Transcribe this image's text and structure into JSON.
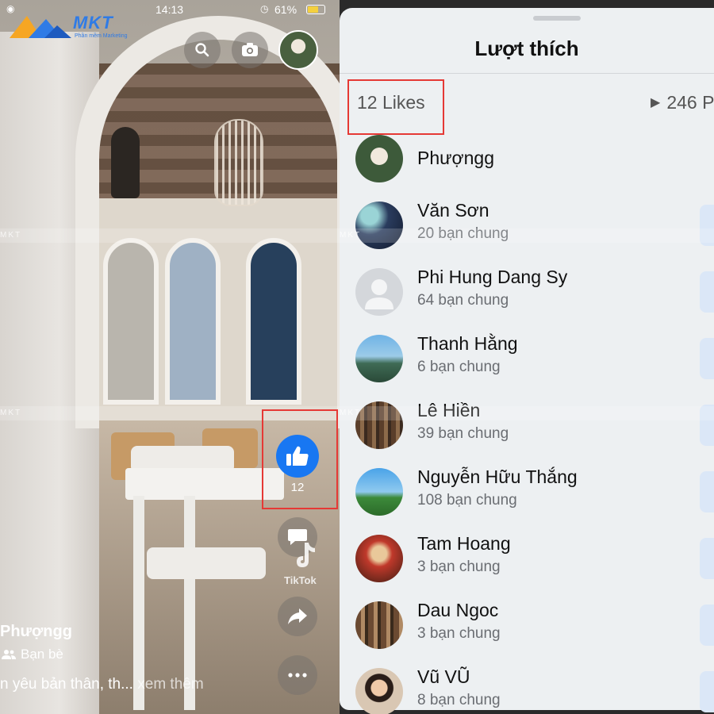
{
  "status_bar": {
    "time": "14:13",
    "battery": "61%"
  },
  "logo": {
    "brand": "MKT",
    "tagline": "Phần mềm Marketing"
  },
  "watermark": "MKT",
  "reel": {
    "like_count": "12",
    "share_app_label": "TikTok",
    "author": "Phượngg",
    "audience": "Bạn bè",
    "caption": "n yêu bản thân, th...",
    "see_more": "xem thêm"
  },
  "likes_sheet": {
    "title": "Lượt thích",
    "likes_count": "12 Likes",
    "plays_count": "246 P",
    "people": [
      {
        "name": "Phượngg",
        "mutual": ""
      },
      {
        "name": "Văn Sơn",
        "mutual": "20 bạn chung"
      },
      {
        "name": "Phi Hung Dang Sy",
        "mutual": "64 bạn chung"
      },
      {
        "name": "Thanh Hằng",
        "mutual": "6 bạn chung"
      },
      {
        "name": "Lê Hiền",
        "mutual": "39 bạn chung"
      },
      {
        "name": "Nguyễn Hữu Thắng",
        "mutual": "108 bạn chung"
      },
      {
        "name": "Tam Hoang",
        "mutual": "3 bạn chung"
      },
      {
        "name": "Dau Ngoc",
        "mutual": "3 bạn chung"
      },
      {
        "name": "Vũ VŨ",
        "mutual": "8 bạn chung"
      }
    ]
  },
  "colors": {
    "accent": "#1877f2",
    "highlight": "#e53935",
    "sheet_bg": "#edf0f2"
  }
}
